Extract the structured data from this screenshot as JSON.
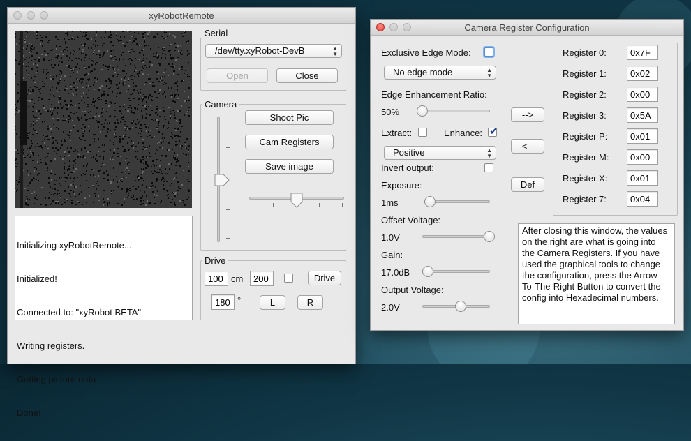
{
  "remote": {
    "title": "xyRobotRemote",
    "serial": {
      "legend": "Serial",
      "port": "/dev/tty.xyRobot-DevB",
      "open_label": "Open",
      "close_label": "Close"
    },
    "camera": {
      "legend": "Camera",
      "shoot_label": "Shoot Pic",
      "registers_label": "Cam Registers",
      "save_label": "Save image"
    },
    "drive": {
      "legend": "Drive",
      "distance": "100",
      "distance_unit": "cm",
      "speed": "200",
      "drive_label": "Drive",
      "angle": "180",
      "angle_unit": "°",
      "left_label": "L",
      "right_label": "R"
    },
    "log_lines": [
      "Initializing xyRobotRemote...",
      "Initialized!",
      "Connected to: \"xyRobot BETA\"",
      "Writing registers.",
      "Getting picture data",
      "Done!"
    ]
  },
  "config": {
    "title": "Camera Register Configuration",
    "exclusive_edge_label": "Exclusive Edge Mode:",
    "edge_mode": "No edge mode",
    "edge_ratio_label": "Edge Enhancement Ratio:",
    "edge_ratio_value": "50%",
    "extract_label": "Extract:",
    "enhance_label": "Enhance:",
    "polarity": "Positive",
    "invert_label": "Invert output:",
    "exposure_label": "Exposure:",
    "exposure_value": "1ms",
    "offset_label": "Offset Voltage:",
    "offset_value": "1.0V",
    "gain_label": "Gain:",
    "gain_value": "17.0dB",
    "output_label": "Output Voltage:",
    "output_value": "2.0V",
    "to_right_label": "-->",
    "to_left_label": "<--",
    "default_label": "Def",
    "registers": [
      {
        "label": "Register 0:",
        "value": "0x7F"
      },
      {
        "label": "Register 1:",
        "value": "0x02"
      },
      {
        "label": "Register 2:",
        "value": "0x00"
      },
      {
        "label": "Register 3:",
        "value": "0x5A"
      },
      {
        "label": "Register P:",
        "value": "0x01"
      },
      {
        "label": "Register M:",
        "value": "0x00"
      },
      {
        "label": "Register X:",
        "value": "0x01"
      },
      {
        "label": "Register 7:",
        "value": "0x04"
      }
    ],
    "help_text": "After closing this window, the values on the right are what is going into the Camera Registers. If you have used the graphical tools to change the configuration, press the Arrow-To-The-Right Button to convert the config into Hexadecimal numbers."
  }
}
